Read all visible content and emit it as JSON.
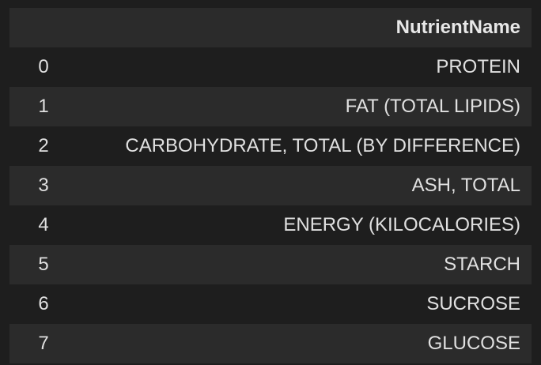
{
  "table": {
    "header": {
      "index_label": "",
      "column_label": "NutrientName"
    },
    "rows": [
      {
        "index": "0",
        "value": "PROTEIN"
      },
      {
        "index": "1",
        "value": "FAT (TOTAL LIPIDS)"
      },
      {
        "index": "2",
        "value": "CARBOHYDRATE, TOTAL (BY DIFFERENCE)"
      },
      {
        "index": "3",
        "value": "ASH, TOTAL"
      },
      {
        "index": "4",
        "value": "ENERGY (KILOCALORIES)"
      },
      {
        "index": "5",
        "value": "STARCH"
      },
      {
        "index": "6",
        "value": "SUCROSE"
      },
      {
        "index": "7",
        "value": "GLUCOSE"
      }
    ]
  }
}
